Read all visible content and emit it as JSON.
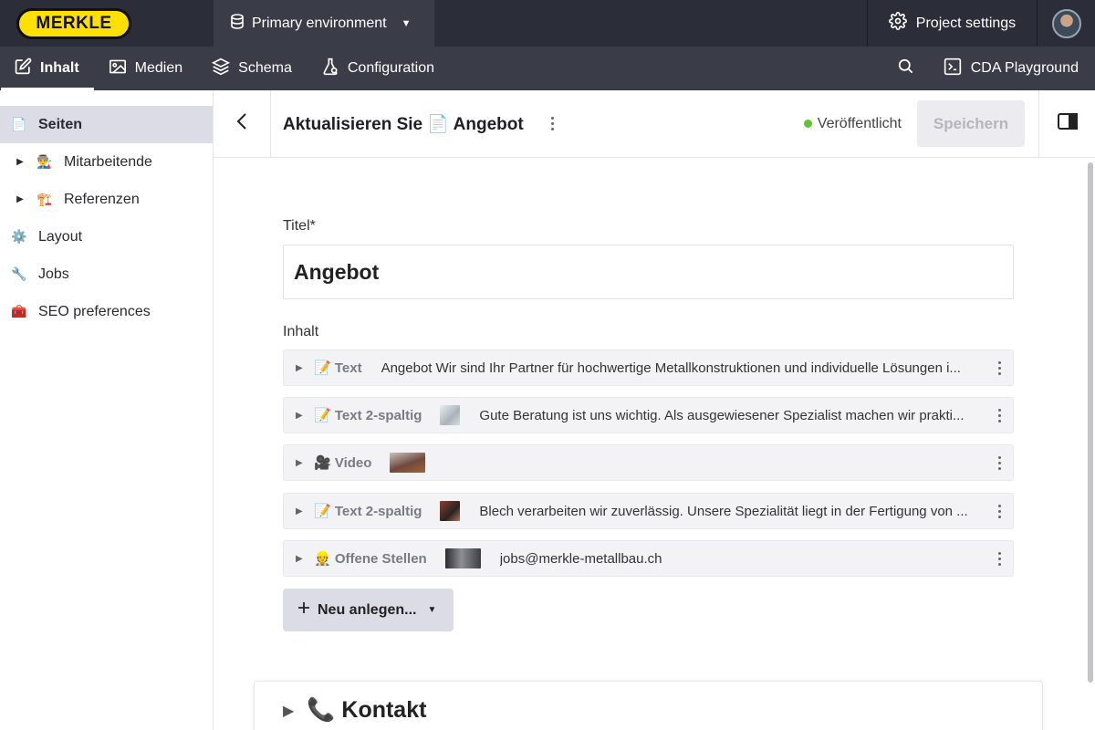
{
  "topbar": {
    "logo_text": "MERKLE",
    "environment": "Primary environment",
    "project_settings": "Project settings"
  },
  "nav": {
    "items": [
      {
        "label": "Inhalt",
        "icon": "edit-icon"
      },
      {
        "label": "Medien",
        "icon": "image-icon"
      },
      {
        "label": "Schema",
        "icon": "layers-icon"
      },
      {
        "label": "Configuration",
        "icon": "flask-icon"
      }
    ],
    "cda": "CDA Playground"
  },
  "sidebar": {
    "items": [
      {
        "label": "Seiten",
        "emoji": "📄"
      },
      {
        "label": "Mitarbeitende",
        "emoji": "👨‍🏭"
      },
      {
        "label": "Referenzen",
        "emoji": "🏗️"
      },
      {
        "label": "Layout",
        "emoji": "⚙️"
      },
      {
        "label": "Jobs",
        "emoji": "🔧"
      },
      {
        "label": "SEO preferences",
        "emoji": "🧰"
      }
    ]
  },
  "header": {
    "title": "Aktualisieren Sie 📄 Angebot",
    "status": "Veröffentlicht",
    "save": "Speichern"
  },
  "form": {
    "title_label": "Titel*",
    "title_value": "Angebot",
    "content_label": "Inhalt",
    "blocks": [
      {
        "type": "📝 Text",
        "text": "Angebot Wir sind Ihr Partner für hochwertige Metallkonstruktionen und individuelle Lösungen i..."
      },
      {
        "type": "📝 Text 2-spaltig",
        "text": "Gute Beratung ist uns wichtig. Als ausgewiesener Spezialist machen wir prakti..."
      },
      {
        "type": "🎥 Video",
        "text": ""
      },
      {
        "type": "📝 Text 2-spaltig",
        "text": "Blech verarbeiten wir zuverlässig. Unsere Spezialität liegt in der Fertigung von ..."
      },
      {
        "type": "👷 Offene Stellen",
        "text": "jobs@merkle-metallbau.ch"
      }
    ],
    "new_button": "Neu anlegen...",
    "section_title": "📞 Kontakt"
  }
}
